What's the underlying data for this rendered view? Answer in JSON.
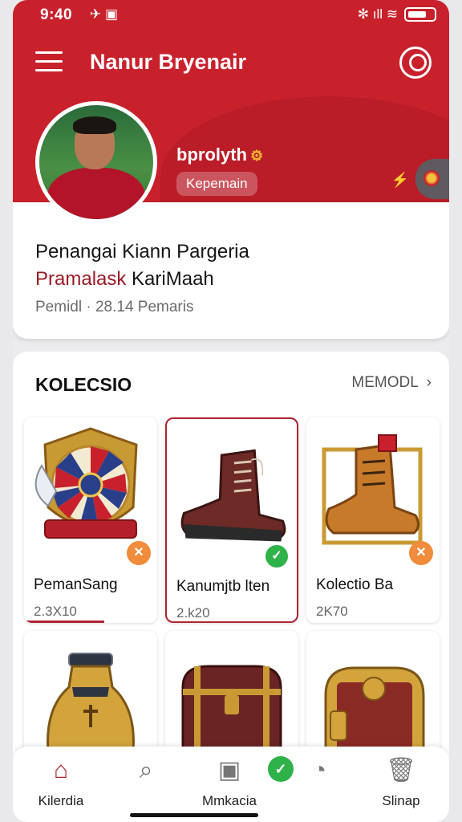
{
  "status": {
    "time": "9:40",
    "left_icons": "✈ ▣",
    "right_icons": "✻ ıll ≋"
  },
  "topbar": {
    "title": "Nanur Bryenair"
  },
  "profile": {
    "name": "bprolyth",
    "role": "Kepemain",
    "line1": "Penangai Kiann Pargeria",
    "line2_accent": "Pramalask",
    "line2_rest": " KariMaah",
    "meta": "Pemidl · 28.14 Pemaris"
  },
  "collection": {
    "title": "KOLECSIO",
    "more_label": "MEMODL",
    "items": [
      {
        "name": "PemanSang",
        "price": "2.3X10"
      },
      {
        "name": "Kanumjtb lten",
        "price": "2.k20"
      },
      {
        "name": "Kolectio Ba",
        "price": "2K70"
      },
      {
        "name": "",
        "price": ""
      },
      {
        "name": "",
        "price": ""
      },
      {
        "name": "",
        "price": ""
      }
    ]
  },
  "bottom_nav": {
    "items": [
      {
        "label": "Kilerdia",
        "icon": "home-icon"
      },
      {
        "label": "",
        "icon": "search-icon"
      },
      {
        "label": "Mmkacia",
        "icon": "scan-icon"
      },
      {
        "label": "",
        "icon": "bell-icon"
      },
      {
        "label": "Slinap",
        "icon": "trash-icon"
      }
    ]
  },
  "colors": {
    "brand": "#c8212c",
    "accent_text": "#9a1b26",
    "success": "#2fb24a",
    "badge": "#f08c3b"
  }
}
